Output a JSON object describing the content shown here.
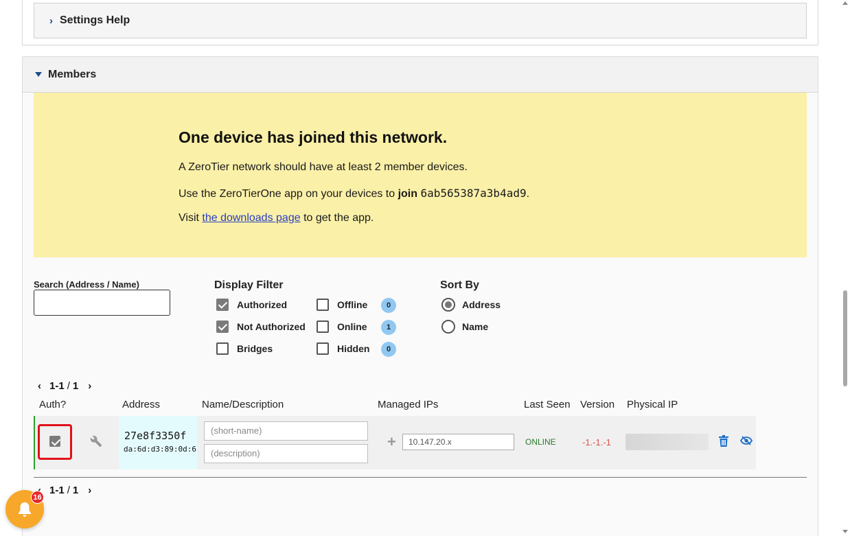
{
  "settings_help": {
    "label": "Settings Help"
  },
  "members": {
    "header": "Members",
    "notice": {
      "title": "One device has joined this network.",
      "line1": "A ZeroTier network should have at least 2 member devices.",
      "line2_pre": "Use the ZeroTierOne app on your devices to ",
      "line2_bold": "join",
      "line2_code": "6ab565387a3b4ad9",
      "line2_post": ".",
      "line3_pre": "Visit ",
      "line3_link": "the downloads page",
      "line3_post": " to get the app."
    },
    "search": {
      "label": "Search (Address / Name)",
      "value": ""
    },
    "display_filter": {
      "title": "Display Filter",
      "authorized": "Authorized",
      "not_authorized": "Not Authorized",
      "bridges": "Bridges",
      "offline": "Offline",
      "online": "Online",
      "hidden": "Hidden",
      "offline_count": "0",
      "online_count": "1",
      "hidden_count": "0"
    },
    "sort_by": {
      "title": "Sort By",
      "address": "Address",
      "name": "Name",
      "selected": "Address"
    },
    "pager_top": {
      "range": "1-1",
      "sep": "/",
      "total": "1"
    },
    "pager_bottom": {
      "range": "1-1",
      "sep": "/",
      "total": "1"
    },
    "columns": {
      "auth": "Auth?",
      "address": "Address",
      "name": "Name/Description",
      "ips": "Managed IPs",
      "last_seen": "Last Seen",
      "version": "Version",
      "physical_ip": "Physical IP"
    },
    "row": {
      "authorized": true,
      "address": "27e8f3350f",
      "mac": "da:6d:d3:89:0d:6",
      "name_placeholder": "(short-name)",
      "desc_placeholder": "(description)",
      "ip": "10.147.20.x",
      "last_seen": "ONLINE",
      "version": "-1.-1.-1"
    }
  },
  "notifications": {
    "count": "16"
  },
  "colors": {
    "notice_bg": "#faf0a8",
    "accent": "#1a4c8c",
    "badge": "#90c8f2",
    "online": "#2a7a2a",
    "highlight": "#e0101a",
    "bell": "#f7a72a"
  }
}
